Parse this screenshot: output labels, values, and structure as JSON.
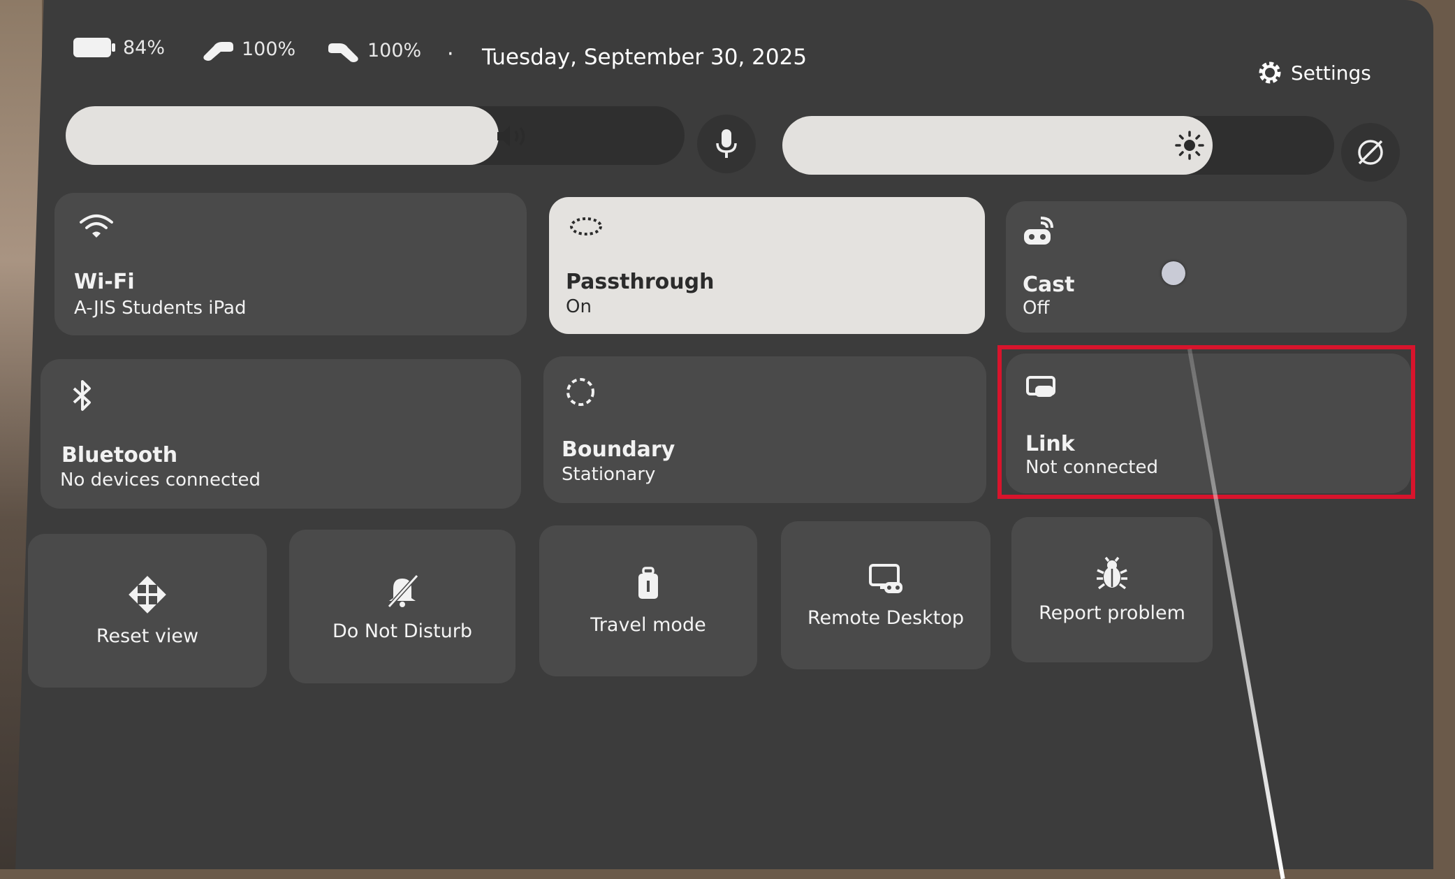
{
  "status_bar": {
    "headset_battery": "84%",
    "left_controller_battery": "100%",
    "right_controller_battery": "100%",
    "separator": "·",
    "date": "Tuesday, September 30, 2025",
    "settings_label": "Settings"
  },
  "sliders": {
    "volume_level": 0.7,
    "brightness_level": 0.78
  },
  "tiles": {
    "wifi": {
      "title": "Wi-Fi",
      "subtitle": "A-JIS Students iPad"
    },
    "passthrough": {
      "title": "Passthrough",
      "subtitle": "On"
    },
    "cast": {
      "title": "Cast",
      "subtitle": "Off"
    },
    "bluetooth": {
      "title": "Bluetooth",
      "subtitle": "No devices connected"
    },
    "boundary": {
      "title": "Boundary",
      "subtitle": "Stationary"
    },
    "link": {
      "title": "Link",
      "subtitle": "Not connected"
    }
  },
  "actions": {
    "reset_view": "Reset view",
    "do_not_disturb": "Do Not Disturb",
    "travel_mode": "Travel mode",
    "remote_desktop": "Remote Desktop",
    "report_problem": "Report problem"
  },
  "colors": {
    "panel": "#3c3c3c",
    "tile": "#4a4a4a",
    "active_tile": "#e4e2df",
    "highlight": "#d8142c"
  }
}
